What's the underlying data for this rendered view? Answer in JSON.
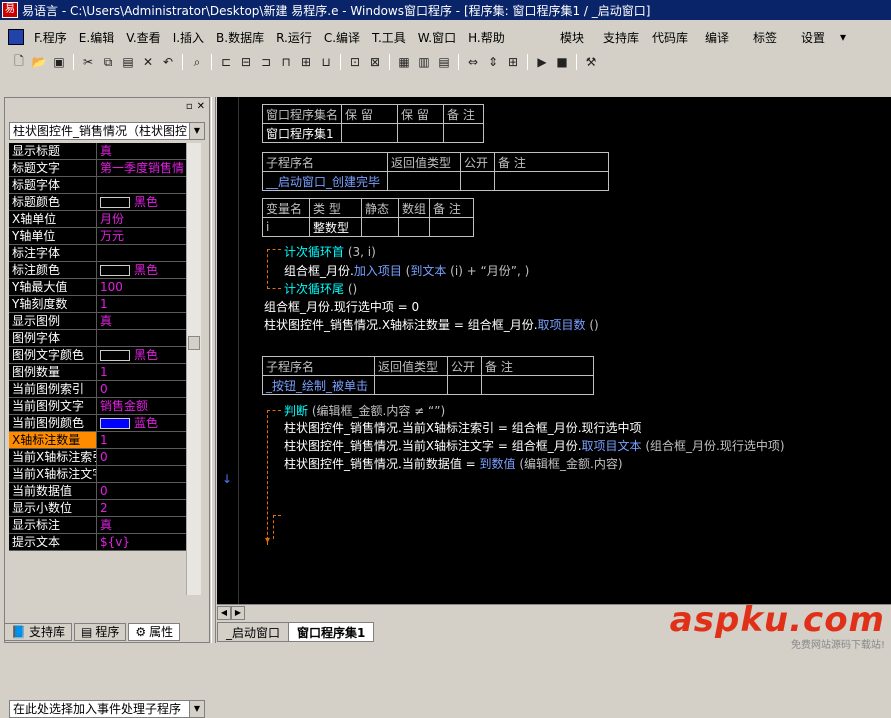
{
  "window": {
    "title": "易语言 - C:\\Users\\Administrator\\Desktop\\新建 易程序.e - Windows窗口程序 - [程序集: 窗口程序集1 / _启动窗口]"
  },
  "menu": [
    "F.程序",
    "E.编辑",
    "V.查看",
    "I.插入",
    "B.数据库",
    "R.运行",
    "C.编译",
    "T.工具",
    "W.窗口",
    "H.帮助"
  ],
  "right_menu": [
    "模块",
    "支持库",
    "代码库",
    "编译",
    "标签",
    "设置"
  ],
  "left_panel": {
    "object_combo": "柱状图控件_销售情况（柱状图控",
    "properties": [
      {
        "k": "显示标题",
        "v": "真"
      },
      {
        "k": "标题文字",
        "v": "第一季度销售情"
      },
      {
        "k": "标题字体",
        "v": ""
      },
      {
        "k": "标题颜色",
        "v": "黑色",
        "swatch": "#000000"
      },
      {
        "k": "X轴单位",
        "v": "月份"
      },
      {
        "k": "Y轴单位",
        "v": "万元"
      },
      {
        "k": "标注字体",
        "v": ""
      },
      {
        "k": "标注颜色",
        "v": "黑色",
        "swatch": "#000000"
      },
      {
        "k": "Y轴最大值",
        "v": "100"
      },
      {
        "k": "Y轴刻度数",
        "v": "1"
      },
      {
        "k": "显示图例",
        "v": "真"
      },
      {
        "k": "图例字体",
        "v": ""
      },
      {
        "k": "图例文字颜色",
        "v": "黑色",
        "swatch": "#000000"
      },
      {
        "k": "图例数量",
        "v": "1"
      },
      {
        "k": "当前图例索引",
        "v": "0"
      },
      {
        "k": "当前图例文字",
        "v": "销售金额"
      },
      {
        "k": "当前图例颜色",
        "v": "蓝色",
        "swatch": "#0000ff"
      },
      {
        "k": "X轴标注数量",
        "v": "1",
        "selected": true
      },
      {
        "k": "当前X轴标注索引",
        "v": "0"
      },
      {
        "k": "当前X轴标注文字",
        "v": ""
      },
      {
        "k": "当前数据值",
        "v": "0"
      },
      {
        "k": "显示小数位",
        "v": "2"
      },
      {
        "k": "显示标注",
        "v": "真"
      },
      {
        "k": "提示文本",
        "v": "${v}"
      }
    ],
    "event_combo": "在此处选择加入事件处理子程序",
    "tabs": [
      "支持库",
      "程序",
      "属性"
    ]
  },
  "editor": {
    "t1": {
      "h": [
        "窗口程序集名",
        "保 留",
        "保 留",
        "备 注"
      ],
      "r": [
        "窗口程序集1",
        "",
        "",
        ""
      ]
    },
    "t2": {
      "h": [
        "子程序名",
        "返回值类型",
        "公开",
        "备 注"
      ],
      "r": [
        "__启动窗口_创建完毕",
        "",
        "",
        ""
      ]
    },
    "t3": {
      "h": [
        "变量名",
        "类 型",
        "静态",
        "数组",
        "备 注"
      ],
      "r": [
        "i",
        "整数型",
        "",
        "",
        ""
      ]
    },
    "lines1": {
      "a1": "计次循环首",
      "a2": " (3, i)",
      "b1": "组合框_月份.",
      "b2": "加入项目",
      "b3": " (",
      "b4": "到文本",
      "b5": " (i) + “月份”, )",
      "c1": "计次循环尾",
      "c2": " ()",
      "d1": "组合框_月份.现行选中项 = 0",
      "e1": "柱状图控件_销售情况.X轴标注数量 = 组合框_月份.",
      "e2": "取项目数",
      "e3": " ()"
    },
    "t4": {
      "h": [
        "子程序名",
        "返回值类型",
        "公开",
        "备 注"
      ],
      "r": [
        "_按钮_绘制_被单击",
        "",
        "",
        ""
      ]
    },
    "lines2": {
      "f1": "判断",
      "f2": " (编辑框_金额.内容 ≠ “”)",
      "g1": "柱状图控件_销售情况.当前X轴标注索引 = 组合框_月份.现行选中项",
      "h1": "柱状图控件_销售情况.当前X轴标注文字 = 组合框_月份.",
      "h2": "取项目文本",
      "h3": " (组合框_月份.现行选中项)",
      "i1": "柱状图控件_销售情况.当前数据值 = ",
      "i2": "到数值",
      "i3": " (编辑框_金额.内容)"
    }
  },
  "bottom_tabs": [
    "_启动窗口",
    "窗口程序集1"
  ],
  "watermark": {
    "big": "aspku.com",
    "small": "免费网站源码下载站!"
  }
}
